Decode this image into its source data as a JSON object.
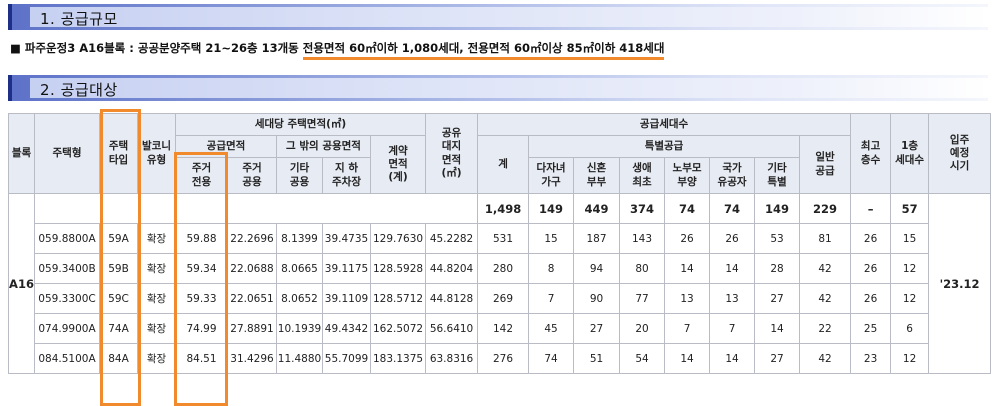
{
  "sections": {
    "scale_title": "1. 공급규모",
    "target_title": "2. 공급대상"
  },
  "summary": {
    "prefix": "■ 파주운정3 A16블록 : 공공분양주택 21~26층 13개동 ",
    "underlined": "전용면적 60㎡이하 1,080세대, 전용면적 60㎡이상 85㎡이하 418세대"
  },
  "table": {
    "headers": {
      "block": "블록",
      "housing_type": "주택형",
      "house_type": "주택\n타입",
      "balcony": "발코니\n유형",
      "area_group": "세대당 주택면적(㎡)",
      "supply_area": "공급면적",
      "other_common": "그 밖의 공용면적",
      "contract_area": "계약\n면적\n(계)",
      "exclusive": "주거\n전용",
      "residential_common": "주거\n공용",
      "other_common_area": "기타\n공용",
      "underground_parking": "지 하\n주차장",
      "land_share": "공유\n대지\n면적\n(㎡)",
      "households_group": "공급세대수",
      "total": "계",
      "special_supply": "특별공급",
      "multi_child": "다자녀\n가구",
      "newlywed": "신혼\n부부",
      "first_time": "생애\n최초",
      "elderly_parents": "노부모\n부양",
      "national_merit": "국가\n유공자",
      "other_special": "기타\n특별",
      "general_supply": "일반\n공급",
      "max_floors": "최고\n층수",
      "first_floor": "1층\n세대수",
      "move_in": "입주\n예정\n시기"
    },
    "block_name": "A16",
    "move_in_date": "'23.12",
    "totals": [
      "1,498",
      "149",
      "449",
      "374",
      "74",
      "74",
      "149",
      "229",
      "–",
      "57"
    ],
    "rows": [
      {
        "housing_type": "059.8800A",
        "house_type": "59A",
        "balcony": "확장",
        "exclusive": "59.88",
        "residential_common": "22.2696",
        "other_common": "8.1399",
        "parking": "39.4735",
        "contract": "129.7630",
        "land": "45.2282",
        "total": "531",
        "multi_child": "15",
        "newlywed": "187",
        "first_time": "143",
        "elderly": "26",
        "merit": "26",
        "other": "53",
        "general": "81",
        "max_floors": "26",
        "first_floor": "15"
      },
      {
        "housing_type": "059.3400B",
        "house_type": "59B",
        "balcony": "확장",
        "exclusive": "59.34",
        "residential_common": "22.0688",
        "other_common": "8.0665",
        "parking": "39.1175",
        "contract": "128.5928",
        "land": "44.8204",
        "total": "280",
        "multi_child": "8",
        "newlywed": "94",
        "first_time": "80",
        "elderly": "14",
        "merit": "14",
        "other": "28",
        "general": "42",
        "max_floors": "26",
        "first_floor": "12"
      },
      {
        "housing_type": "059.3300C",
        "house_type": "59C",
        "balcony": "확장",
        "exclusive": "59.33",
        "residential_common": "22.0651",
        "other_common": "8.0652",
        "parking": "39.1109",
        "contract": "128.5712",
        "land": "44.8128",
        "total": "269",
        "multi_child": "7",
        "newlywed": "90",
        "first_time": "77",
        "elderly": "13",
        "merit": "13",
        "other": "27",
        "general": "42",
        "max_floors": "26",
        "first_floor": "12"
      },
      {
        "housing_type": "074.9900A",
        "house_type": "74A",
        "balcony": "확장",
        "exclusive": "74.99",
        "residential_common": "27.8891",
        "other_common": "10.1939",
        "parking": "49.4342",
        "contract": "162.5072",
        "land": "56.6410",
        "total": "142",
        "multi_child": "45",
        "newlywed": "27",
        "first_time": "20",
        "elderly": "7",
        "merit": "7",
        "other": "14",
        "general": "22",
        "max_floors": "25",
        "first_floor": "6"
      },
      {
        "housing_type": "084.5100A",
        "house_type": "84A",
        "balcony": "확장",
        "exclusive": "84.51",
        "residential_common": "31.4296",
        "other_common": "11.4880",
        "parking": "55.7099",
        "contract": "183.1375",
        "land": "63.8316",
        "total": "276",
        "multi_child": "74",
        "newlywed": "51",
        "first_time": "54",
        "elderly": "14",
        "merit": "14",
        "other": "27",
        "general": "42",
        "max_floors": "23",
        "first_floor": "12"
      }
    ]
  },
  "colors": {
    "highlight": "#f08a2c",
    "header_bg": "#e7ebf3",
    "section_bar": "#1d2f86"
  }
}
